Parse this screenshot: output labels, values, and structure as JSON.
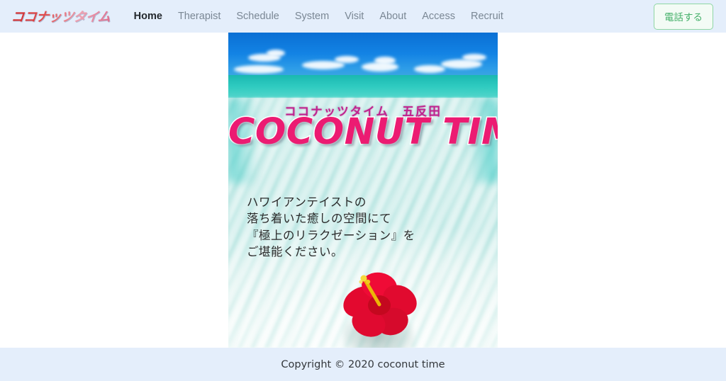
{
  "header": {
    "brand_text": "ココナッツタイム",
    "nav_items": [
      {
        "label": "Home",
        "active": true
      },
      {
        "label": "Therapist",
        "active": false
      },
      {
        "label": "Schedule",
        "active": false
      },
      {
        "label": "System",
        "active": false
      },
      {
        "label": "Visit",
        "active": false
      },
      {
        "label": "About",
        "active": false
      },
      {
        "label": "Access",
        "active": false
      },
      {
        "label": "Recruit",
        "active": false
      }
    ],
    "call_button_label": "電話する",
    "background_color": "#e4eefb",
    "accent_green": "#45b06a"
  },
  "hero": {
    "subtitle": "ココナッツタイム　五反田",
    "title": "COCONUT TIME",
    "body_text": "ハワイアンテイストの\n落ち着いた癒しの空間にて\n『極上のリラクゼーション』を\nご堪能ください。",
    "title_color": "#ec1b72",
    "subtitle_color": "#c0218f",
    "image_alt": "tropical-beach-with-hibiscus",
    "flower_icon": "hibiscus-flower-icon"
  },
  "footer": {
    "copyright": "Copyright © 2020 coconut time",
    "background_color": "#e4eefb"
  }
}
